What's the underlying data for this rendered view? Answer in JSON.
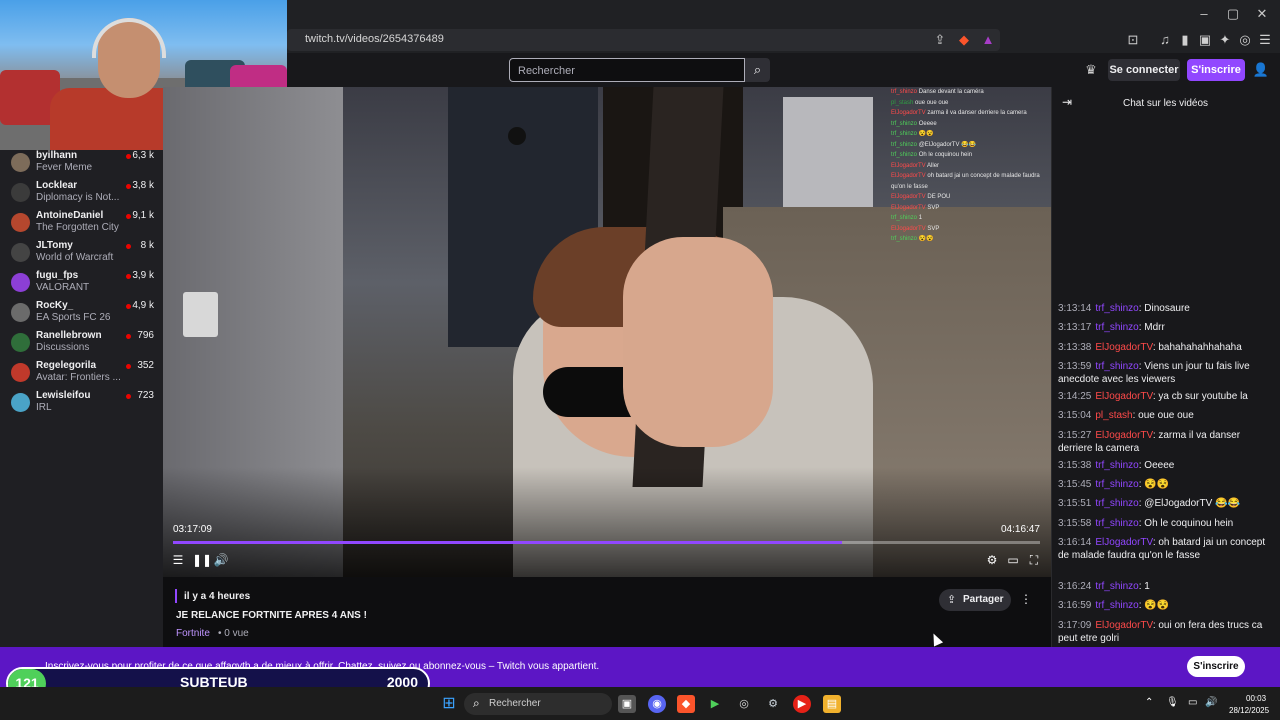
{
  "browser": {
    "url": "twitch.tv/videos/2654376489"
  },
  "header": {
    "search_placeholder": "Rechercher",
    "login_label": "Se connecter",
    "signup_label": "S'inscrire"
  },
  "sidebar": {
    "items": [
      {
        "name": "byilhann",
        "game": "Fever Meme",
        "viewers": "6,3 k",
        "avatar_color": "#7d6c5a"
      },
      {
        "name": "Locklear",
        "game": "Diplomacy is Not...",
        "viewers": "3,8 k",
        "avatar_color": "#3b3b3b"
      },
      {
        "name": "AntoineDaniel",
        "game": "The Forgotten City",
        "viewers": "9,1 k",
        "avatar_color": "#b5472e"
      },
      {
        "name": "JLTomy",
        "game": "World of Warcraft",
        "viewers": "8 k",
        "avatar_color": "#444"
      },
      {
        "name": "fugu_fps",
        "game": "VALORANT",
        "viewers": "3,9 k",
        "avatar_color": "#8c3fd6"
      },
      {
        "name": "RocKy_",
        "game": "EA Sports FC 26",
        "viewers": "4,9 k",
        "avatar_color": "#6b6b6b"
      },
      {
        "name": "Ranellebrown",
        "game": "Discussions",
        "viewers": "796",
        "avatar_color": "#2f6e3a"
      },
      {
        "name": "Regelegorila",
        "game": "Avatar: Frontiers ...",
        "viewers": "352",
        "avatar_color": "#c0392b"
      },
      {
        "name": "Lewisleifou",
        "game": "IRL",
        "viewers": "723",
        "avatar_color": "#4aa3c7"
      }
    ]
  },
  "player": {
    "time_current": "03:17:09",
    "time_total": "04:16:47",
    "progress": 0.772
  },
  "video_overlay_chat": [
    {
      "user": "trf_shinzo",
      "text": "Danse devant la caméra",
      "color": "#ff4a4a"
    },
    {
      "user": "pl_stash",
      "text": "oue oue oue",
      "color": "#2ea043"
    },
    {
      "user": "ElJogadorTV",
      "text": "zarma il va danser derriere la camera",
      "color": "#ff4a4a"
    },
    {
      "user": "trf_shinzo",
      "text": "Oeeee",
      "color": "#4fd05a"
    },
    {
      "user": "trf_shinzo",
      "text": "😵😵",
      "color": "#4fd05a"
    },
    {
      "user": "trf_shinzo",
      "text": "@ElJogadorTV 😂😂",
      "color": "#4fd05a"
    },
    {
      "user": "trf_shinzo",
      "text": "Oh le coquinou hein",
      "color": "#4fd05a"
    },
    {
      "user": "ElJogadorTV",
      "text": "Aller",
      "color": "#ff4a4a"
    },
    {
      "user": "ElJogadorTV",
      "text": "oh batard jai un concept de malade faudra qu'on le fasse",
      "color": "#ff4a4a"
    },
    {
      "user": "ElJogadorTV",
      "text": "DE POU",
      "color": "#ff4a4a"
    },
    {
      "user": "ElJogadorTV",
      "text": "SVP",
      "color": "#ff4a4a"
    },
    {
      "user": "trf_shinzo",
      "text": "1",
      "color": "#4fd05a"
    },
    {
      "user": "ElJogadorTV",
      "text": "SVP",
      "color": "#ff4a4a"
    },
    {
      "user": "trf_shinzo",
      "text": "😵😵",
      "color": "#4fd05a"
    }
  ],
  "video_info": {
    "age": "il y a 4 heures",
    "title": "JE RELANCE FORTNITE APRES 4 ANS !",
    "game": "Fortnite",
    "views": "• 0 vue",
    "share_label": "Partager"
  },
  "chat": {
    "title": "Chat sur les vidéos",
    "messages": [
      {
        "time": "3:13:14",
        "user": "trf_shinzo",
        "text": ": Dinosaure",
        "color_class": "cu-purple"
      },
      {
        "time": "3:13:17",
        "user": "trf_shinzo",
        "text": ": Mdrr",
        "color_class": "cu-purple"
      },
      {
        "time": "3:13:38",
        "user": "ElJogadorTV",
        "text": ": bahahahahhahaha",
        "color_class": "cu-red"
      },
      {
        "time": "3:13:59",
        "user": "trf_shinzo",
        "text": ": Viens un jour tu fais live anecdote avec les viewers",
        "color_class": "cu-purple"
      },
      {
        "time": "3:14:25",
        "user": "ElJogadorTV",
        "text": ": ya cb sur youtube la",
        "color_class": "cu-red"
      },
      {
        "time": "3:15:04",
        "user": "pl_stash",
        "text": ": oue oue oue",
        "color_class": "cu-red"
      },
      {
        "time": "3:15:27",
        "user": "ElJogadorTV",
        "text": ": zarma il va danser derriere la camera",
        "color_class": "cu-red"
      },
      {
        "time": "3:15:38",
        "user": "trf_shinzo",
        "text": ": Oeeee",
        "color_class": "cu-purple"
      },
      {
        "time": "3:15:45",
        "user": "trf_shinzo",
        "text": ": 😵😵",
        "color_class": "cu-purple"
      },
      {
        "time": "3:15:51",
        "user": "trf_shinzo",
        "text": ": @ElJogadorTV 😂😂",
        "color_class": "cu-purple"
      },
      {
        "time": "3:15:58",
        "user": "trf_shinzo",
        "text": ": Oh le coquinou hein",
        "color_class": "cu-purple"
      },
      {
        "time": "3:16:14",
        "user": "ElJogadorTV",
        "text": ": oh batard jai un concept de malade faudra qu'on le fasse",
        "color_class": "cu-purple"
      },
      {
        "time": "3:16:24",
        "user": "trf_shinzo",
        "text": ": 1",
        "color_class": "cu-purple"
      },
      {
        "time": "3:16:59",
        "user": "trf_shinzo",
        "text": ": 😵😵",
        "color_class": "cu-purple"
      },
      {
        "time": "3:17:09",
        "user": "ElJogadorTV",
        "text": ": oui on fera des trucs ca peut etre golri",
        "color_class": "cu-red"
      }
    ]
  },
  "banner": {
    "text": "Inscrivez-vous pour profiter de ce que affagytb a de mieux à offrir. Chattez, suivez ou abonnez-vous – Twitch vous appartient.",
    "button": "S'inscrire"
  },
  "sub_goal": {
    "count": "121",
    "label": "SUBTEUB",
    "target": "2000"
  },
  "taskbar": {
    "search_placeholder": "Rechercher",
    "time": "00:03",
    "date": "28/12/2025"
  },
  "colors": {
    "twitch_purple": "#9147ff",
    "banner": "#5c16c5",
    "live_red": "#eb0400"
  }
}
